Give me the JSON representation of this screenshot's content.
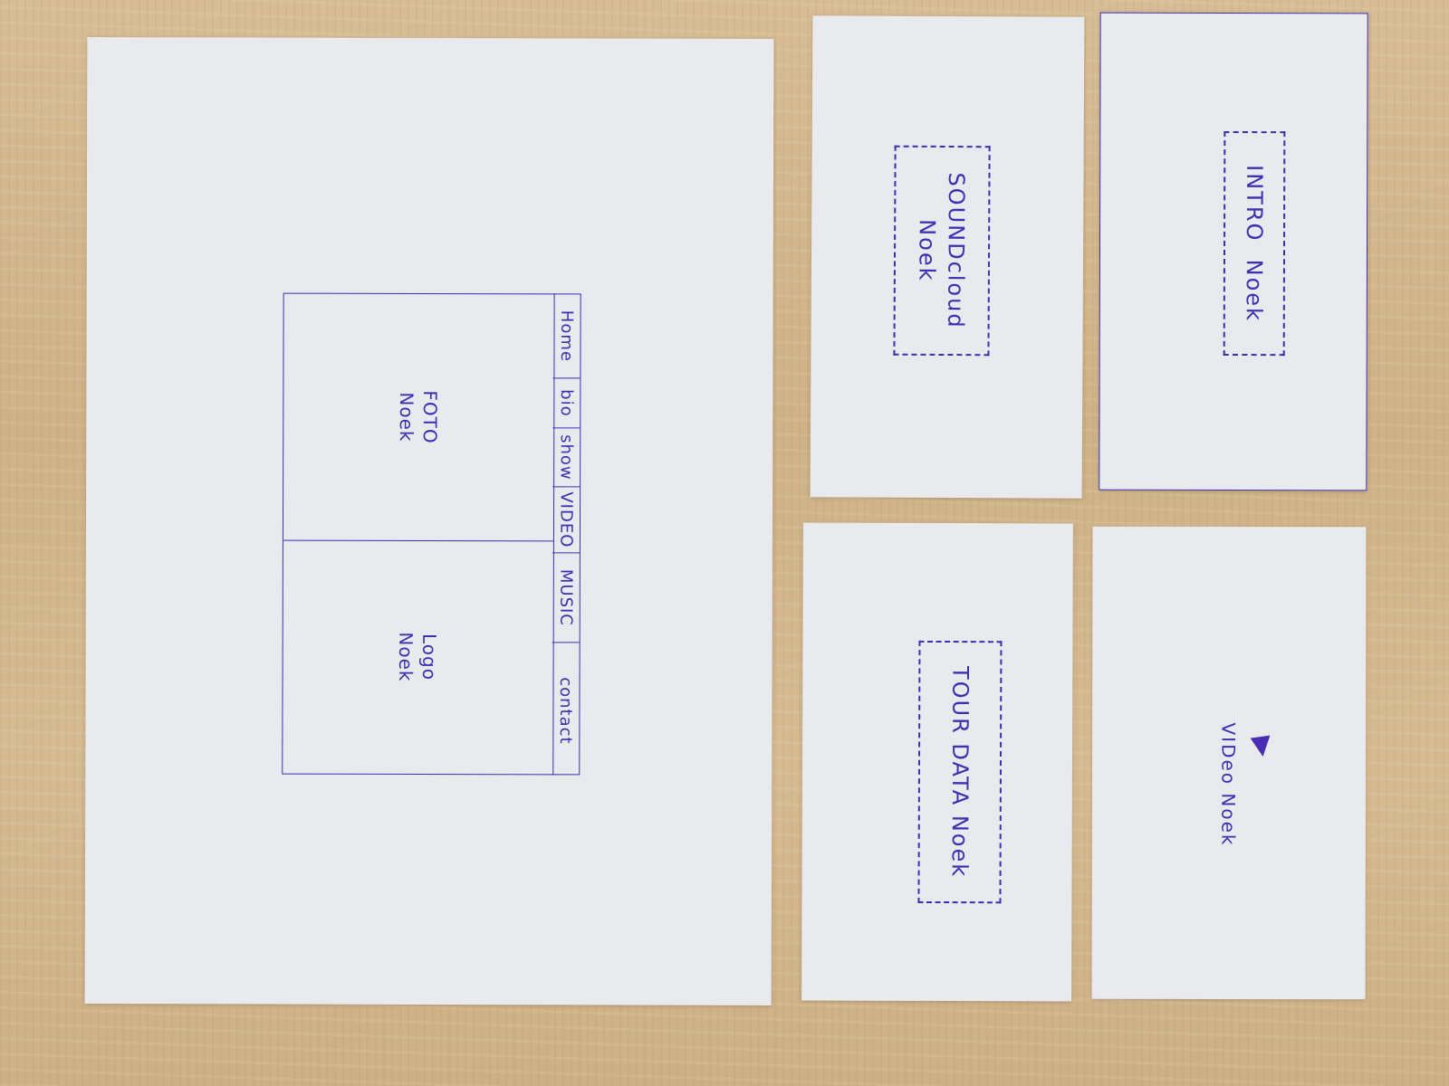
{
  "main_sheet": {
    "photo_label": "FOTO\nNoek",
    "logo_label": "Logo\nNoek",
    "nav": [
      {
        "label": "Home",
        "height": 92
      },
      {
        "label": "bio",
        "height": 54
      },
      {
        "label": "show",
        "height": 64
      },
      {
        "label": "VIDEO",
        "height": 72
      },
      {
        "label": "MUSIC",
        "height": 98
      },
      {
        "label": "contact",
        "height": 150
      }
    ]
  },
  "soundcloud_sheet": {
    "label": "SOUNDcloud\nNoek"
  },
  "intro_sheet": {
    "label": "INTRO  Noek"
  },
  "tour_sheet": {
    "label": "TOUR DATA Noek"
  },
  "video_sheet": {
    "label": "VIDeo Noek",
    "icon": "play-icon"
  },
  "colors": {
    "ink": "#3c2fb0",
    "paper": "#e9eaee",
    "wood": "#d2b68c"
  }
}
